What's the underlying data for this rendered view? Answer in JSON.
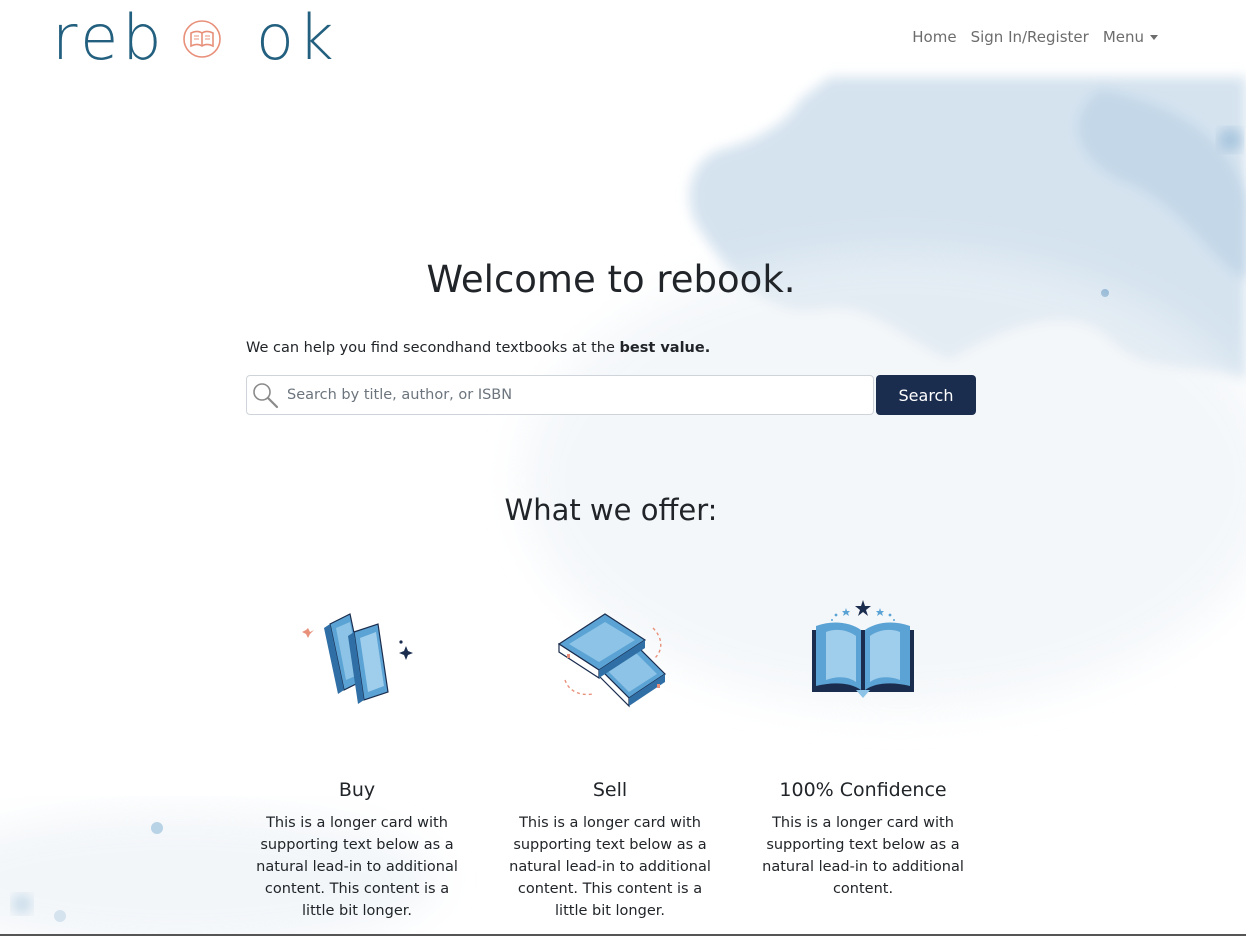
{
  "brand": {
    "logo_left": "reb",
    "logo_right": "ok"
  },
  "nav": {
    "items": [
      {
        "label": "Home"
      },
      {
        "label": "Sign In/Register"
      },
      {
        "label": "Menu"
      }
    ]
  },
  "hero": {
    "title": "Welcome to rebook.",
    "tagline_prefix": "We can help you find secondhand textbooks at the ",
    "tagline_bold": "best value."
  },
  "search": {
    "placeholder": "Search by title, author, or ISBN",
    "value": "",
    "button_label": "Search"
  },
  "offers": {
    "title": "What we offer:",
    "cards": [
      {
        "title": "Buy",
        "text": "This is a longer card with supporting text below as a natural lead-in to additional content. This content is a little bit longer.",
        "icon": "books-stack-icon"
      },
      {
        "title": "Sell",
        "text": "This is a longer card with supporting text below as a natural lead-in to additional content. This content is a little bit longer.",
        "icon": "books-pile-icon"
      },
      {
        "title": "100% Confidence",
        "text": "This is a longer card with supporting text below as a natural lead-in to additional content.",
        "icon": "open-book-icon"
      }
    ]
  },
  "colors": {
    "brand": "#23607f",
    "button": "#1b2d4f",
    "accent": "#e8907a",
    "icon_blue": "#5ba3d4"
  }
}
